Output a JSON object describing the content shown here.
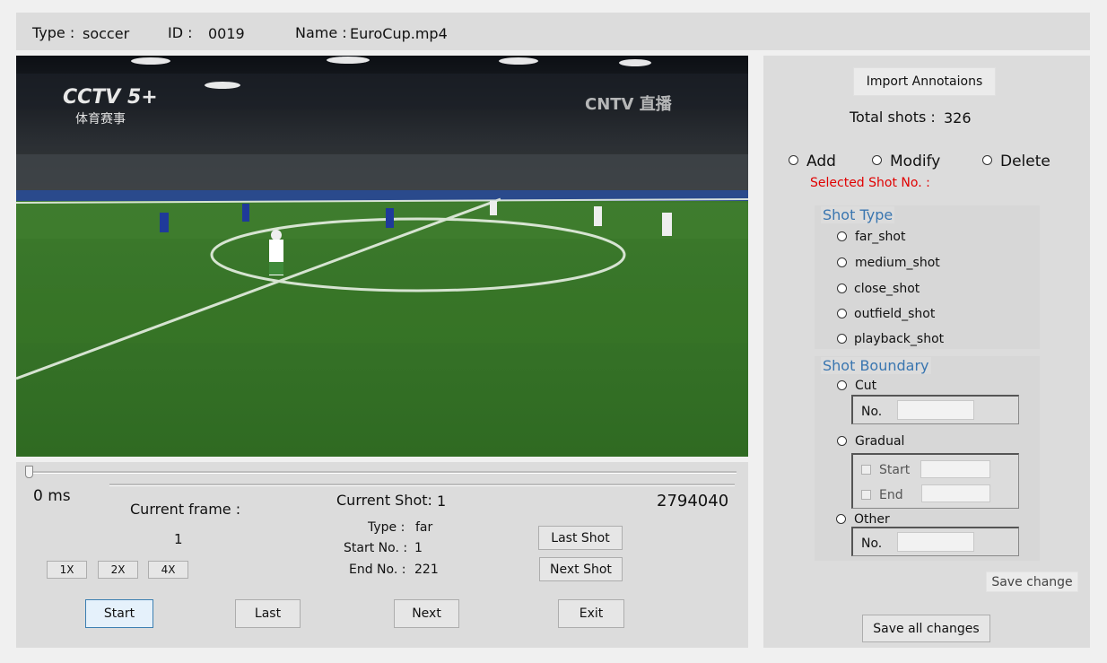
{
  "header": {
    "type_label": "Type :",
    "type_value": "soccer",
    "id_label": "ID :",
    "id_value": "0019",
    "name_label": "Name :",
    "name_value": "EuroCup.mp4"
  },
  "video": {
    "logo_left": "CCTV 5+",
    "logo_left_sub": "体育赛事",
    "logo_right": "CNTV 直播"
  },
  "player": {
    "progress": 0,
    "time_start": "0 ms",
    "time_end": "2794040",
    "current_frame_label": "Current frame :",
    "current_frame_value": "1",
    "speed_buttons": [
      "1X",
      "2X",
      "4X"
    ],
    "current_shot_label": "Current Shot:",
    "current_shot_value": "1",
    "shot_type_label": "Type :",
    "shot_type_value": "far",
    "start_no_label": "Start No. :",
    "start_no_value": "1",
    "end_no_label": "End No. :",
    "end_no_value": "221",
    "last_shot": "Last Shot",
    "next_shot": "Next Shot",
    "start": "Start",
    "last": "Last",
    "next": "Next",
    "exit": "Exit"
  },
  "annotations": {
    "import_button": "Import Annotaions",
    "total_shots_label": "Total shots :",
    "total_shots_value": "326",
    "modes": [
      "Add",
      "Modify",
      "Delete"
    ],
    "selected_shot_label": "Selected Shot No. :",
    "shot_type_title": "Shot Type",
    "shot_types": [
      "far_shot",
      "medium_shot",
      "close_shot",
      "outfield_shot",
      "playback_shot"
    ],
    "shot_boundary_title": "Shot Boundary",
    "boundary_cut": "Cut",
    "boundary_gradual": "Gradual",
    "boundary_other": "Other",
    "no_label": "No.",
    "start_label": "Start",
    "end_label": "End",
    "save_change": "Save change",
    "save_all": "Save all changes"
  },
  "colors": {
    "accent": "#3a76b0",
    "warning": "#e00000",
    "panel": "#dcdcdc"
  }
}
